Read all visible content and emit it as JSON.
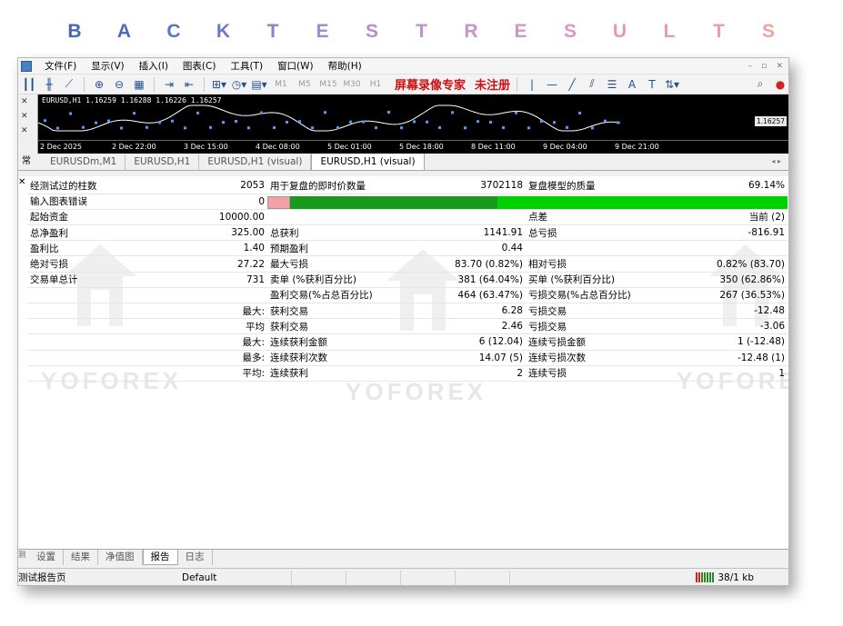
{
  "banner": {
    "letters": [
      "B",
      "A",
      "C",
      "K",
      "T",
      "E",
      "S",
      "T",
      "R",
      "E",
      "S",
      "U",
      "L",
      "T",
      "S"
    ],
    "colors": [
      "#4666b8",
      "#4a6cbc",
      "#5a74c4",
      "#6a7cc8",
      "#7e86cc",
      "#a08cd0",
      "#b48ed0",
      "#c090d0",
      "#c893cc",
      "#d096c8",
      "#d898c0",
      "#e09ab8",
      "#e69cb0",
      "#ec9ea8",
      "#f2a0a0"
    ]
  },
  "menubar": {
    "items": [
      "文件(F)",
      "显示(V)",
      "插入(I)",
      "图表(C)",
      "工具(T)",
      "窗口(W)",
      "帮助(H)"
    ],
    "watermark": "屏幕录像专家",
    "watermark2": "未注册"
  },
  "chart": {
    "header": "EURUSD,H1  1.16259 1.16288 1.16226 1.16257",
    "price_top": "1.16330",
    "price_label": "1.16257",
    "time_labels": [
      "2 Dec 2025",
      "2 Dec 22:00",
      "3 Dec 15:00",
      "4 Dec 08:00",
      "5 Dec 01:00",
      "5 Dec 18:00",
      "8 Dec 11:00",
      "9 Dec 04:00",
      "9 Dec 21:00"
    ]
  },
  "tabs": {
    "corner": "常",
    "items": [
      "EURUSDm,M1",
      "EURUSD,H1",
      "EURUSD,H1 (visual)",
      "EURUSD,H1 (visual)"
    ],
    "active_index": 3
  },
  "report": {
    "rows": [
      [
        "经测试过的柱数",
        "2053",
        "用于复盘的即时价数量",
        "3702118",
        "复盘模型的质量",
        "69.14%"
      ],
      [
        "输入图表错误",
        "0",
        "",
        "",
        "",
        ""
      ],
      [
        "起始资金",
        "10000.00",
        "",
        "",
        "点差",
        "当前 (2)"
      ],
      [
        "总净盈利",
        "325.00",
        "总获利",
        "1141.91",
        "总亏损",
        "-816.91"
      ],
      [
        "盈利比",
        "1.40",
        "预期盈利",
        "0.44",
        "",
        ""
      ],
      [
        "绝对亏损",
        "27.22",
        "最大亏损",
        "83.70 (0.82%)",
        "相对亏损",
        "0.82% (83.70)"
      ],
      [
        "交易单总计",
        "731",
        "卖单 (%获利百分比)",
        "381 (64.04%)",
        "买单 (%获利百分比)",
        "350 (62.86%)"
      ],
      [
        "",
        "",
        "盈利交易(%占总百分比)",
        "464 (63.47%)",
        "亏损交易(%占总百分比)",
        "267 (36.53%)"
      ],
      [
        "",
        "最大:",
        "获利交易",
        "6.28",
        "亏损交易",
        "-12.48"
      ],
      [
        "",
        "平均",
        "获利交易",
        "2.46",
        "亏损交易",
        "-3.06"
      ],
      [
        "",
        "最大:",
        "连续获利金额",
        "6 (12.04)",
        "连续亏损金额",
        "1 (-12.48)"
      ],
      [
        "",
        "最多:",
        "连续获利次数",
        "14.07 (5)",
        "连续亏损次数",
        "-12.48 (1)"
      ],
      [
        "",
        "平均:",
        "连续获利",
        "2",
        "连续亏损",
        "1"
      ]
    ],
    "quality_fraction": 0.6914
  },
  "watermarks": [
    "YOFOREX",
    "YOFOREX",
    "YOFOREX"
  ],
  "bottom_tabs": {
    "items": [
      "设置",
      "结果",
      "净值图",
      "报告",
      "日志"
    ],
    "active_index": 3
  },
  "statusbar": {
    "left": "测试报告页",
    "profile": "Default",
    "traffic": "38/1 kb"
  }
}
